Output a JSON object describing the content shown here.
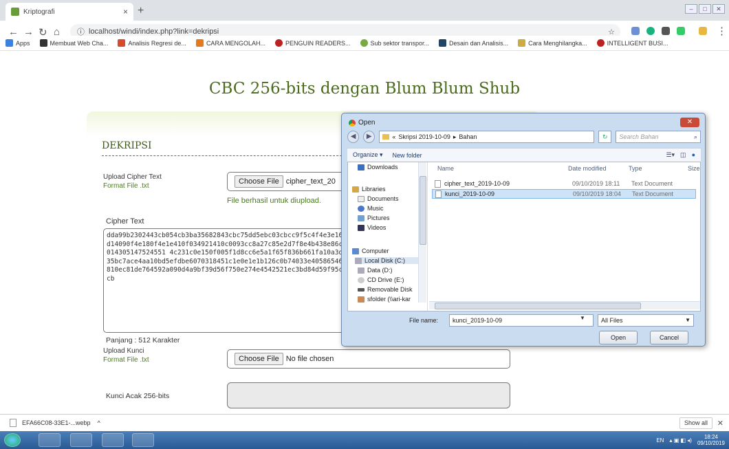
{
  "browser": {
    "tab_title": "Kriptografi",
    "url": "localhost/windi/index.php?link=dekripsi",
    "bookmarks": [
      "Apps",
      "Membuat Web Cha...",
      "Analisis Regresi de...",
      "CARA MENGOLAH...",
      "PENGUIN READERS...",
      "Sub sektor transpor...",
      "Desain dan Analisis...",
      "Cara Menghilangka...",
      "INTELLIGENT BUSI..."
    ]
  },
  "page": {
    "title": "CBC 256-bits dengan Blum Blum Shub",
    "section": "DEKRIPSI",
    "upload_cipher_label": "Upload Cipher Text",
    "format_label": "Format File .txt",
    "choose_file": "Choose File",
    "cipher_file_name": "cipher_text_20",
    "upload_success": "File berhasil untuk diupload.",
    "cipher_text_label": "Cipher Text",
    "cipher_text": "dda99b2302443cb054cb3ba35682843cbc75dd5ebc03cbcc9f5c4f4e3e161d14090f4e180f4e1e410f034921410c0093cc8a27c85e2d7f8e4b438e86c6014305147524551 4c231c0e150f005f1d8cc6e5a1f65f836b661fa10a3d335bc7ace4aa10bd5efdbe6070318451c1e0e1e1b126c0b74033e405865460810ec81de764592a090d4a9bf39d56f750e274e4542521ec3bd84d59f95c7cb",
    "length_label": "Panjang : 512 Karakter",
    "upload_key_label": "Upload Kunci",
    "key_format_label": "Format File .txt",
    "no_file": "No file chosen",
    "random_key_label": "Kunci Acak 256-bits"
  },
  "dialog": {
    "title": "Open",
    "breadcrumb": [
      "«",
      "Skripsi 2019-10-09",
      "Bahan"
    ],
    "search_placeholder": "Search Bahan",
    "organize": "Organize ▾",
    "new_folder": "New folder",
    "nav_items": [
      "Downloads",
      "Libraries",
      "Documents",
      "Music",
      "Pictures",
      "Videos",
      "Computer",
      "Local Disk (C:)",
      "Data (D:)",
      "CD Drive (E:)",
      "Removable Disk",
      "sfolder (\\\\ari-kar"
    ],
    "columns": [
      "Name",
      "Date modified",
      "Type",
      "Size"
    ],
    "files": [
      {
        "name": "cipher_text_2019-10-09",
        "date": "09/10/2019 18:11",
        "type": "Text Document"
      },
      {
        "name": "kunci_2019-10-09",
        "date": "09/10/2019 18:04",
        "type": "Text Document"
      }
    ],
    "file_name_label": "File name:",
    "file_name_value": "kunci_2019-10-09",
    "filter": "All Files",
    "open_button": "Open",
    "cancel_button": "Cancel"
  },
  "downloads": {
    "file": "EFA66C08-33E1-...webp",
    "show_all": "Show all"
  },
  "taskbar": {
    "lang": "EN",
    "time": "18:24",
    "date": "09/10/2019"
  },
  "colors": {
    "accent": "#4a7a1e",
    "title": "#4b6b1c"
  }
}
